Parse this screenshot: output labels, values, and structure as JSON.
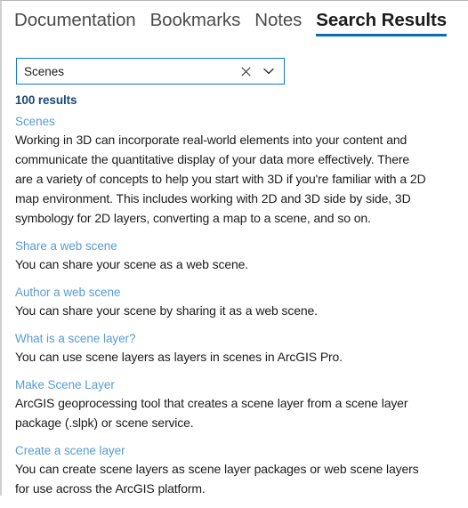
{
  "tabs": [
    {
      "label": "Documentation",
      "active": false
    },
    {
      "label": "Bookmarks",
      "active": false
    },
    {
      "label": "Notes",
      "active": false
    },
    {
      "label": "Search Results",
      "active": true
    }
  ],
  "search": {
    "value": "Scenes",
    "placeholder": "Search",
    "clear_icon": "close-x-icon",
    "dropdown_icon": "chevron-down-icon",
    "border_color": "#0d7ac4"
  },
  "results": {
    "count_label": "100 results",
    "count_color": "#1b4a74",
    "link_color": "#5a9bd4",
    "items": [
      {
        "title": "Scenes",
        "snippet": "Working in 3D can incorporate real-world elements into your content and communicate the quantitative display of your data more effectively. There are a variety of concepts to help you start with 3D if you're familiar with a 2D map environment. This includes working with 2D and 3D side by side, 3D symbology for 2D layers, converting a map to a scene, and so on."
      },
      {
        "title": "Share a web scene",
        "snippet": "You can share your scene as a web scene."
      },
      {
        "title": "Author a web scene",
        "snippet": "You can share your scene by sharing it as a web scene."
      },
      {
        "title": "What is a scene layer?",
        "snippet": "You can use scene layers as layers in scenes in ArcGIS Pro."
      },
      {
        "title": "Make Scene Layer",
        "snippet": "ArcGIS geoprocessing tool that creates a scene layer from a scene layer package (.slpk) or scene service."
      },
      {
        "title": "Create a scene layer",
        "snippet": "You can create scene layers as scene layer packages or web scene layers for use across the ArcGIS platform."
      }
    ]
  }
}
